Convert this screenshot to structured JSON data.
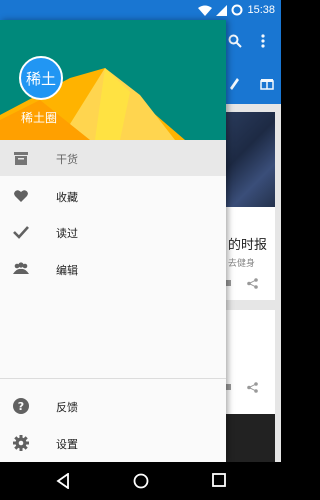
{
  "status_bar": {
    "time": "15:38",
    "icons": [
      "wifi-icon",
      "signal-icon",
      "battery-icon"
    ],
    "color": "#1976d2"
  },
  "drawer": {
    "avatar_text": "稀土",
    "username": "稀土圈",
    "header_color": "#00897b",
    "items": [
      {
        "label": "干货",
        "icon": "archive-icon",
        "selected": true
      },
      {
        "label": "收藏",
        "icon": "heart-icon",
        "selected": false
      },
      {
        "label": "读过",
        "icon": "check-icon",
        "selected": false
      },
      {
        "label": "编辑",
        "icon": "group-icon",
        "selected": false
      }
    ],
    "bottom_items": [
      {
        "label": "反馈",
        "icon": "help-icon"
      },
      {
        "label": "设置",
        "icon": "settings-icon"
      }
    ]
  },
  "background": {
    "card_title": "的时报",
    "card_subtitle": "去健身"
  },
  "nav_bar": {
    "buttons": [
      "back-icon",
      "home-icon",
      "recents-icon"
    ]
  }
}
